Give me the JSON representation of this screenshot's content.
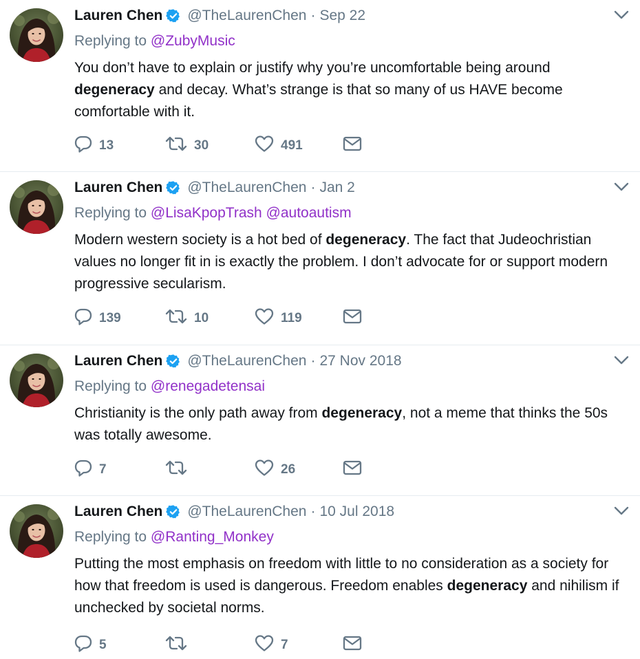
{
  "colors": {
    "text": "#14171a",
    "secondary": "#657786",
    "mention": "#9131c8",
    "verified": "#1da1f2",
    "divider": "#e6ecf0"
  },
  "icons": {
    "verified": "verified-badge-icon",
    "caret": "chevron-down-icon",
    "reply": "reply-bubble-icon",
    "retweet": "retweet-icon",
    "like": "heart-icon",
    "dm": "envelope-icon"
  },
  "replying_prefix": "Replying to",
  "tweets": [
    {
      "name": "Lauren Chen",
      "handle": "@TheLaurenChen",
      "separator": "·",
      "date": "Sep 22",
      "mentions": [
        "@ZubyMusic"
      ],
      "text_parts": [
        "You don’t have to explain or justify why you’re uncomfortable being around ",
        "degeneracy",
        " and decay. What’s strange is that so many of us HAVE become comfortable with it."
      ],
      "replies": "13",
      "retweets": "30",
      "likes": "491"
    },
    {
      "name": "Lauren Chen",
      "handle": "@TheLaurenChen",
      "separator": "·",
      "date": "Jan 2",
      "mentions": [
        "@LisaKpopTrash",
        "@autoautism"
      ],
      "text_parts": [
        "Modern western society is a hot bed of ",
        "degeneracy",
        ". The fact that Judeochristian values no longer fit in is exactly the problem. I don’t advocate for or support modern progressive secularism."
      ],
      "replies": "139",
      "retweets": "10",
      "likes": "119"
    },
    {
      "name": "Lauren Chen",
      "handle": "@TheLaurenChen",
      "separator": "·",
      "date": "27 Nov 2018",
      "mentions": [
        "@renegadetensai"
      ],
      "text_parts": [
        "Christianity is the only path away from ",
        "degeneracy",
        ", not a meme that thinks the 50s was totally awesome."
      ],
      "replies": "7",
      "retweets": "",
      "likes": "26"
    },
    {
      "name": "Lauren Chen",
      "handle": "@TheLaurenChen",
      "separator": "·",
      "date": "10 Jul 2018",
      "mentions": [
        "@Ranting_Monkey"
      ],
      "text_parts": [
        "Putting the most emphasis on freedom with little to no consideration as a society for how that freedom is used is dangerous. Freedom enables ",
        "degeneracy",
        " and nihilism if unchecked by societal norms."
      ],
      "replies": "5",
      "retweets": "",
      "likes": "7"
    }
  ]
}
